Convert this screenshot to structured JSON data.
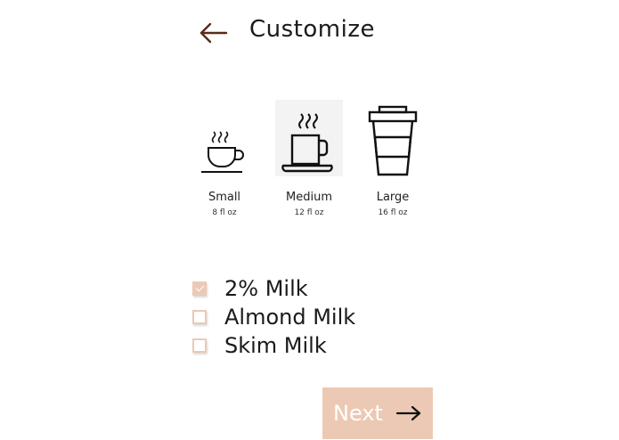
{
  "header": {
    "title": "Customize",
    "back_icon": "arrow-left-icon"
  },
  "sizes": [
    {
      "name": "Small",
      "volume": "8 fl oz",
      "icon": "cup-small-icon",
      "selected": false
    },
    {
      "name": "Medium",
      "volume": "12 fl oz",
      "icon": "cup-medium-icon",
      "selected": true
    },
    {
      "name": "Large",
      "volume": "16 fl oz",
      "icon": "cup-large-icon",
      "selected": false
    }
  ],
  "milk_options": [
    {
      "label": "2% Milk",
      "checked": true
    },
    {
      "label": "Almond Milk",
      "checked": false
    },
    {
      "label": "Skim Milk",
      "checked": false
    }
  ],
  "next_button": {
    "label": "Next",
    "icon": "arrow-right-icon"
  },
  "colors": {
    "accent": "#ecc9b4",
    "text": "#1a1a1a",
    "icon_header": "#5a2a1a"
  }
}
